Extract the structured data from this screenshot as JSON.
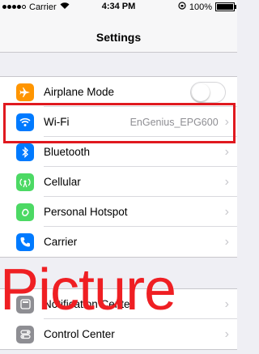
{
  "status_bar": {
    "carrier": "Carrier",
    "time": "4:34 PM",
    "battery": "100%"
  },
  "nav": {
    "title": "Settings"
  },
  "group1": [
    {
      "label": "Airplane Mode",
      "icon": "airplane-icon",
      "color": "#ff9500",
      "control": "toggle",
      "toggle_on": false
    },
    {
      "label": "Wi-Fi",
      "icon": "wifi-icon",
      "color": "#007aff",
      "value": "EnGenius_EPG600"
    },
    {
      "label": "Bluetooth",
      "icon": "bluetooth-icon",
      "color": "#007aff"
    },
    {
      "label": "Cellular",
      "icon": "cellular-icon",
      "color": "#4cd964"
    },
    {
      "label": "Personal Hotspot",
      "icon": "hotspot-icon",
      "color": "#4cd964"
    },
    {
      "label": "Carrier",
      "icon": "phone-icon",
      "color": "#007aff"
    }
  ],
  "group2": [
    {
      "label": "Notification Center",
      "icon": "notification-icon",
      "color": "#8e8e93"
    },
    {
      "label": "Control Center",
      "icon": "control-center-icon",
      "color": "#8e8e93"
    }
  ],
  "watermark": "Picture",
  "highlight_color": "#e0191f"
}
